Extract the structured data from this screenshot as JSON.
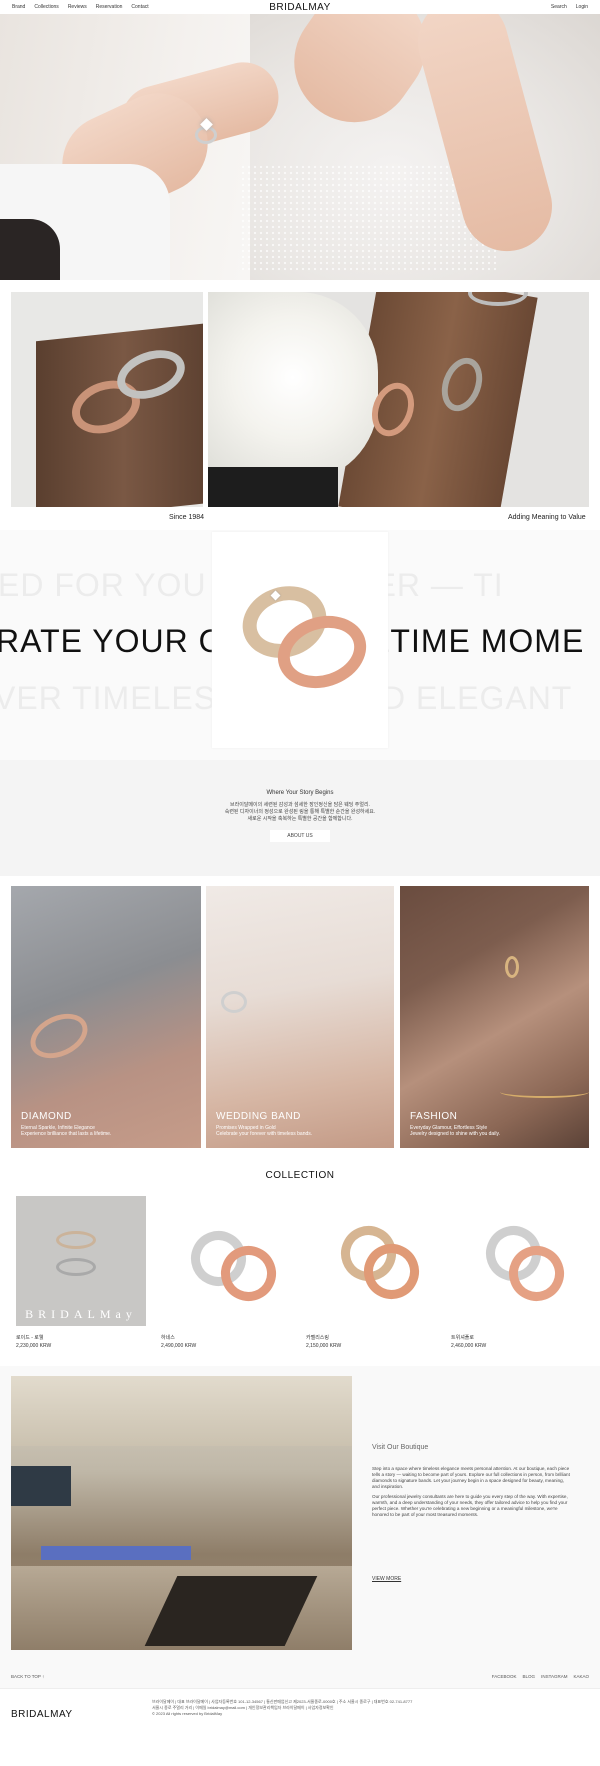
{
  "header": {
    "nav": [
      "Brand",
      "Collections",
      "Reviews",
      "Reservation",
      "Contact"
    ],
    "logo": "BRIDALMAY",
    "search": "Search",
    "login": "Login"
  },
  "photos": {
    "caption_left": "Since 1984",
    "caption_right": "Adding Meaning to Value"
  },
  "marquee": {
    "line1": "ED FOR YOU — FOREVER — TI",
    "line2": "RATE YOUR ON          FETIME MOME",
    "line3": "VER TIMELESS          AND ELEGANT"
  },
  "about": {
    "title": "Where Your Story Begins",
    "text_line1": "브라이달메이의 세련된 감성과 섬세한 장인정신을 담은 웨딩 주얼리.",
    "text_line2": "숙련된 디자이너의 정성으로 완성된 링을 통해 특별한 순간을 완성하세요.",
    "text_line3": "새로운 시작을 축복하는 특별한 공간을 함께합니다.",
    "button": "ABOUT US"
  },
  "categories": [
    {
      "title": "DIAMOND",
      "sub1": "Eternal Sparkle, Infinite Elegance",
      "sub2": "Experience brilliance that lasts a lifetime."
    },
    {
      "title": "WEDDING BAND",
      "sub1": "Promises Wrapped in Gold",
      "sub2": "Celebrate your forever with timeless bands."
    },
    {
      "title": "FASHION",
      "sub1": "Everyday Glamour, Effortless Style",
      "sub2": "Jewelry designed to shine with you daily."
    }
  ],
  "collection": {
    "title": "COLLECTION",
    "items": [
      {
        "name": "로이드 - 로웰",
        "price": "2,230,000 KRW",
        "watermark": "BRIDALMay"
      },
      {
        "name": "하네스",
        "price": "2,490,000 KRW"
      },
      {
        "name": "카멜리스링",
        "price": "2,150,000 KRW"
      },
      {
        "name": "트위셔플로",
        "price": "2,460,000 KRW"
      }
    ]
  },
  "boutique": {
    "title": "Visit Our Boutique",
    "p1": "Step into a space where timeless elegance meets personal attention. At our boutique, each piece tells a story — waiting to become part of yours. Explore our full collections in person, from brilliant diamonds to signature bands. Let your journey begin in a space designed for beauty, meaning, and inspiration.",
    "p2": "Our professional jewelry consultants are here to guide you every step of the way. With expertise, warmth, and a deep understanding of your needs, they offer tailored advice to help you find your perfect piece. Whether you're celebrating a new beginning or a meaningful milestone, we're honored to be part of your most treasured moments.",
    "view_more": "VIEW MORE"
  },
  "footer": {
    "back_to_top": "BACK TO TOP  ↑",
    "links": [
      "FACEBOOK",
      "BLOG",
      "INSTAGRAM",
      "KAKAO"
    ],
    "logo": "BRIDALMAY",
    "info1": "브라이달메이 | 대표 브라이달메이 | 사업자등록번호 101-12-34567 | 통신판매업신고 제2023-서울종로-0000호 | 주소 서울시 종로구 | 대표번호 02-741-8777",
    "info2": "서울시 종로 주얼리 거리 | 이메일 bridalmay@mail.com | 개인정보관리책임자 브라이달메이 | 사업자정보확인",
    "info3": "© 2023 All rights reserved by BridalMay"
  },
  "colors": {
    "accent": "#111111",
    "gold": "#c9a27a",
    "rose_gold": "#d98f6e",
    "silver": "#c7c7c7"
  }
}
